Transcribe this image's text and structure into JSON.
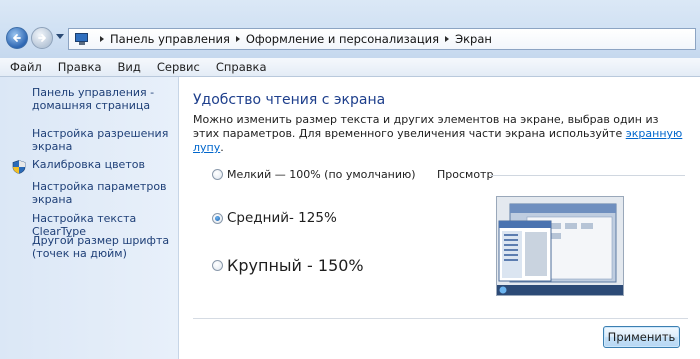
{
  "breadcrumb": {
    "items": [
      "Панель управления",
      "Оформление и персонализация",
      "Экран"
    ]
  },
  "menu": [
    "Файл",
    "Правка",
    "Вид",
    "Сервис",
    "Справка"
  ],
  "sidebar": {
    "home_link": "Панель управления - домашняя страница",
    "links": [
      "Настройка разрешения экрана",
      "Калибровка цветов",
      "Настройка параметров экрана",
      "Настройка текста ClearType",
      "Другой размер шрифта (точек на дюйм)"
    ]
  },
  "main": {
    "title": "Удобство чтения с экрана",
    "description_before_link": "Можно изменить размер текста и других элементов на экране, выбрав один из этих параметров. Для временного увеличения части экрана используйте ",
    "description_link": "экранную лупу",
    "description_after_link": ".",
    "options": [
      {
        "label": "Мелкий — 100% (по умолчанию)",
        "selected": false
      },
      {
        "label": "Средний- 125%",
        "selected": true
      },
      {
        "label": "Крупный - 150%",
        "selected": false
      }
    ],
    "preview_label": "Просмотр",
    "apply_button": "Применить"
  },
  "colors": {
    "link": "#1e3f77",
    "title": "#1e3f8c",
    "sidebar_bg": "#dbe7f6"
  },
  "icons": {
    "back": "back-arrow-icon",
    "forward": "forward-arrow-icon",
    "location": "monitor-icon",
    "calibration": "shield-icon"
  }
}
